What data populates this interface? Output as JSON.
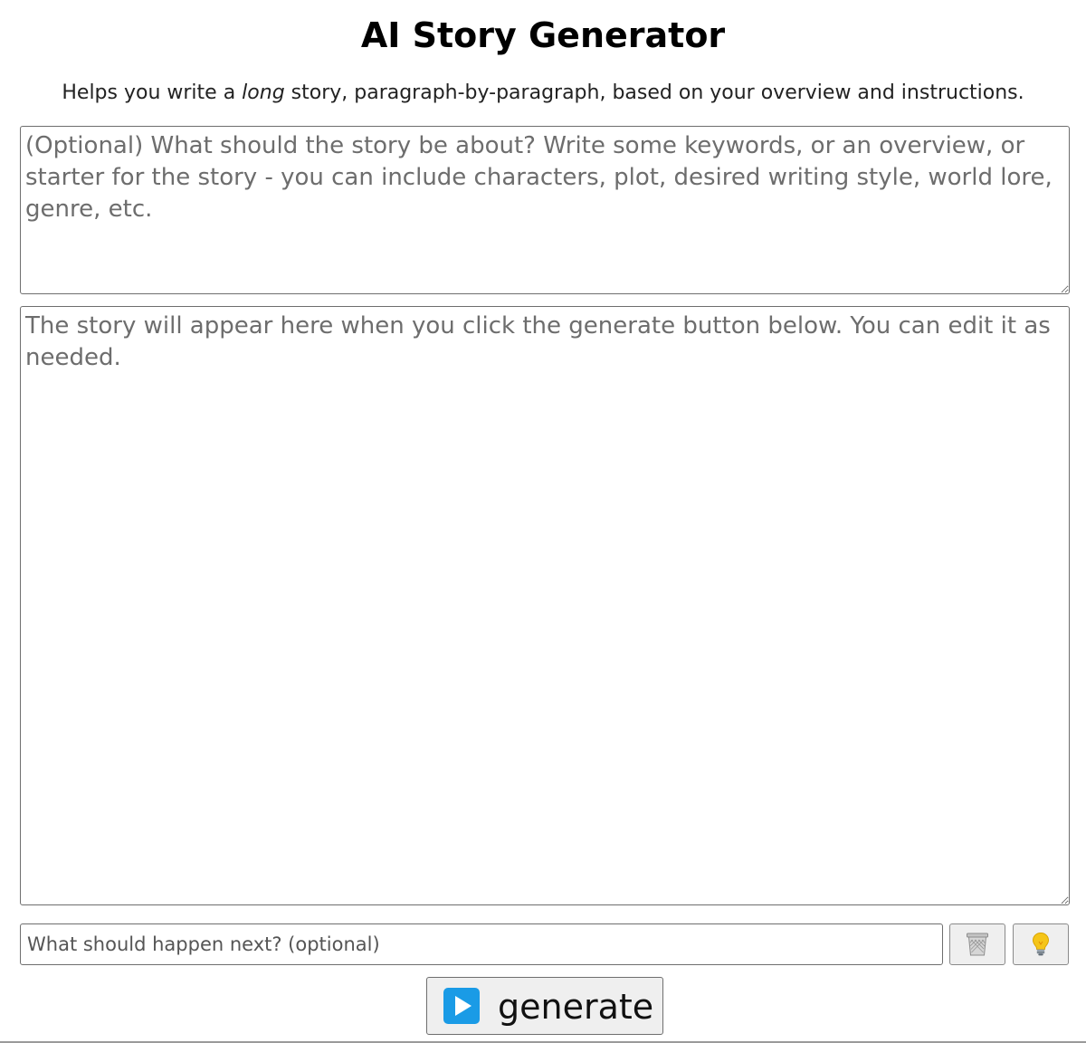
{
  "header": {
    "title": "AI Story Generator",
    "subtitle_before": "Helps you write a ",
    "subtitle_emphasis": "long",
    "subtitle_after": " story, paragraph-by-paragraph, based on your overview and instructions."
  },
  "overview": {
    "value": "",
    "placeholder": "(Optional) What should the story be about? Write some keywords, or an overview, or starter for the story - you can include characters, plot, desired writing style, world lore, genre, etc."
  },
  "story": {
    "value": "",
    "placeholder": "The story will appear here when you click the generate button below. You can edit it as needed."
  },
  "next_instruction": {
    "value": "",
    "placeholder": "What should happen next? (optional)"
  },
  "buttons": {
    "clear_icon": "wastebasket-icon",
    "idea_icon": "lightbulb-icon",
    "generate_icon": "play-icon",
    "generate_label": "generate"
  },
  "colors": {
    "play_icon": "#1a9be6",
    "bulb": "#f5c518"
  }
}
